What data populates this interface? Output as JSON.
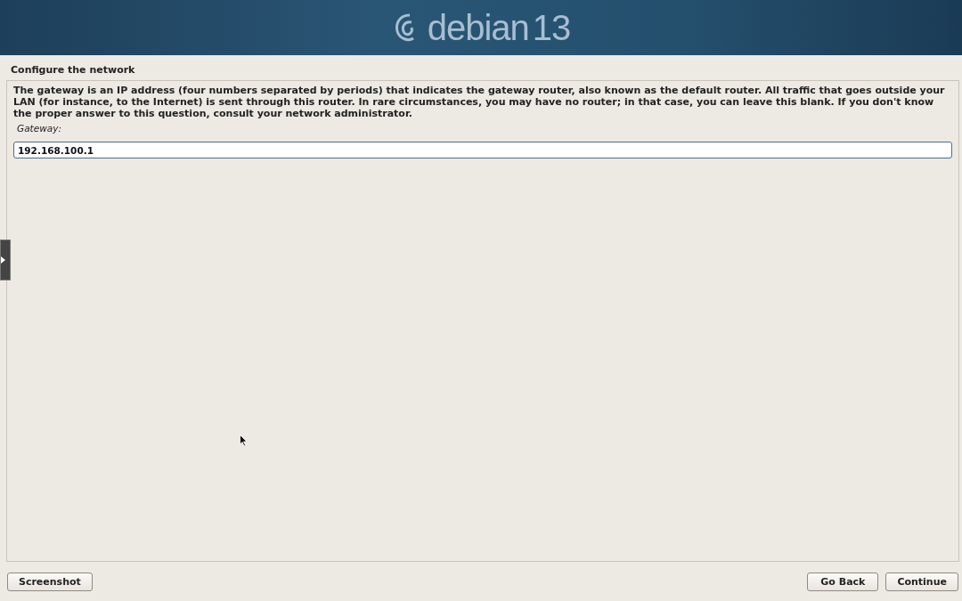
{
  "banner": {
    "logo_text": "debian",
    "version": "13"
  },
  "title": "Configure the network",
  "question": {
    "description": "The gateway is an IP address (four numbers separated by periods) that indicates the gateway router, also known as the default router.  All traffic that goes outside your LAN (for instance, to the Internet) is sent through this router.  In rare circumstances, you may have no router; in that case, you can leave this blank.  If you don't know the proper answer to this question, consult your network administrator.",
    "field_label": "Gateway:",
    "value": "192.168.100.1"
  },
  "buttons_left": [
    "Screenshot"
  ],
  "buttons_right": [
    "Go Back",
    "Continue"
  ]
}
